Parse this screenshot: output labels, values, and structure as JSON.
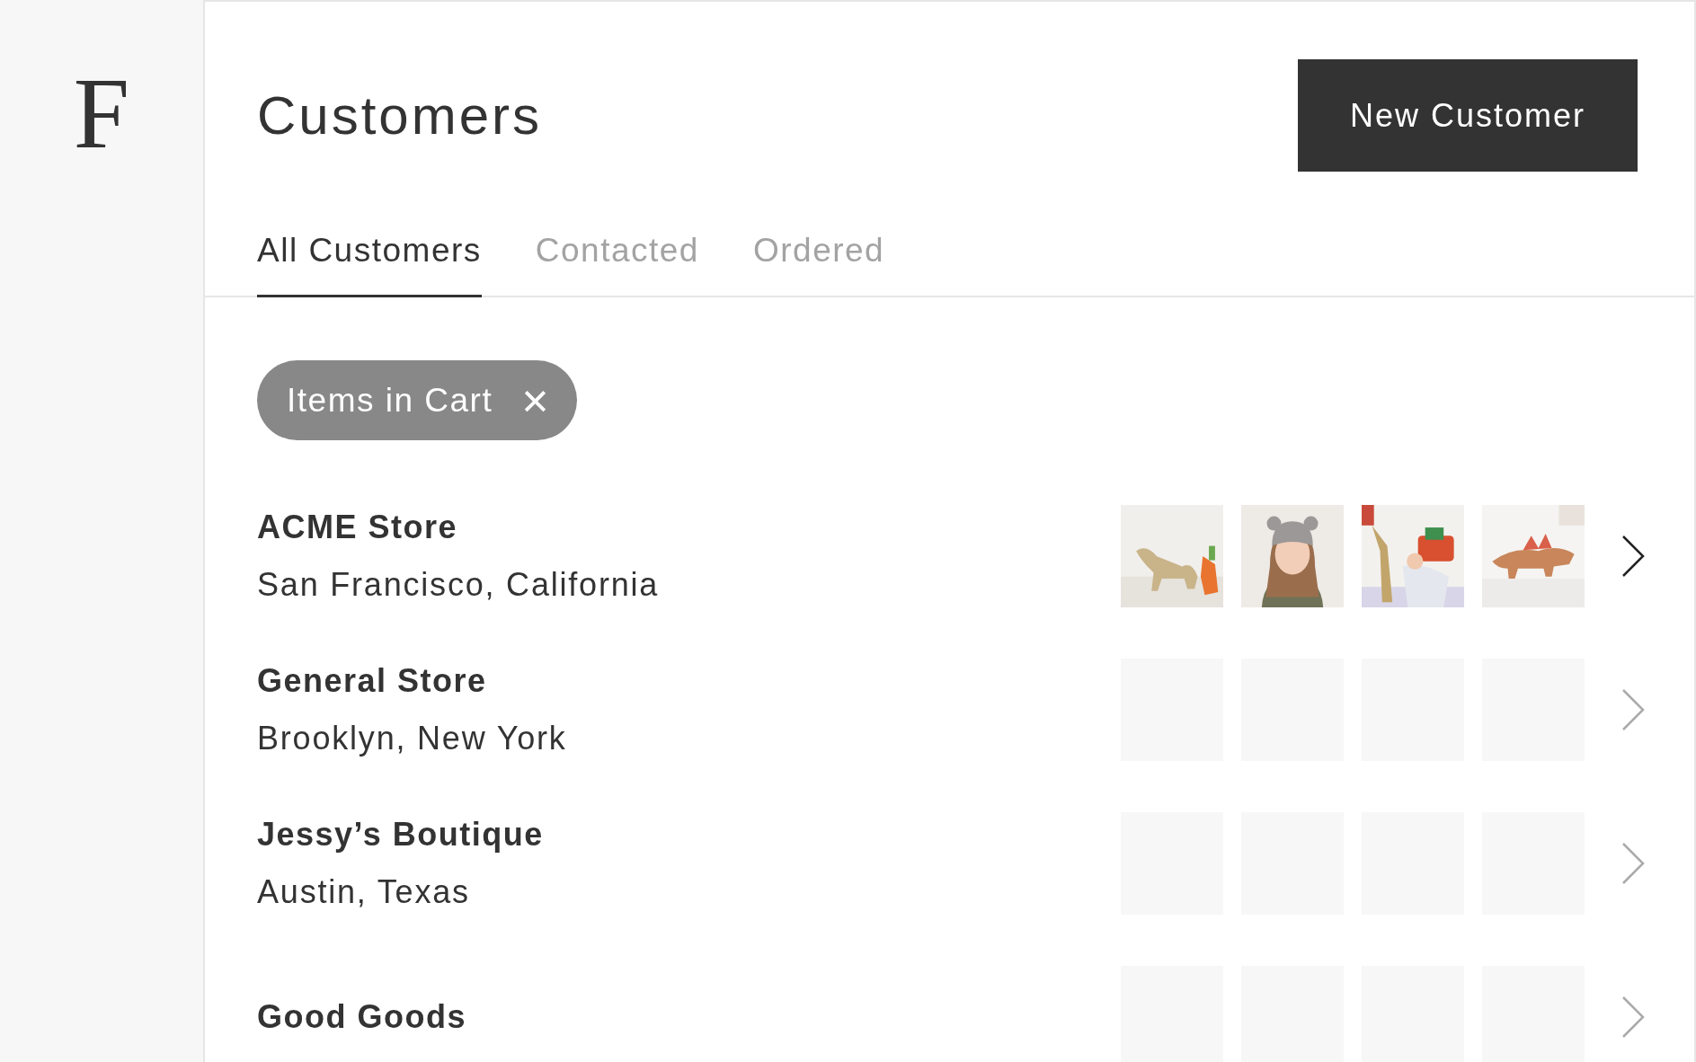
{
  "sidebar": {
    "logo": "F"
  },
  "header": {
    "title": "Customers",
    "button": "New Customer"
  },
  "tabs": [
    {
      "label": "All Customers",
      "selected": true
    },
    {
      "label": "Contacted",
      "selected": false
    },
    {
      "label": "Ordered",
      "selected": false
    }
  ],
  "filters": [
    {
      "label": "Items in Cart",
      "close": "×"
    }
  ],
  "customers": [
    {
      "name": "ACME Store",
      "location": "San Francisco, California",
      "active": true
    },
    {
      "name": "General Store",
      "location": "Brooklyn, New York",
      "active": false,
      "thumbnails": [
        {
          "kind": "empty"
        },
        {
          "kind": "empty"
        },
        {
          "kind": "empty"
        },
        {
          "kind": "empty"
        }
      ]
    },
    {
      "name": "Jessy’s Boutique",
      "location": "Austin, Texas",
      "active": false,
      "thumbnails": [
        {
          "kind": "empty"
        },
        {
          "kind": "empty"
        },
        {
          "kind": "empty"
        },
        {
          "kind": "empty"
        }
      ]
    },
    {
      "name": "Good Goods",
      "active": false,
      "thumbnails": [
        {
          "kind": "empty"
        },
        {
          "kind": "empty"
        },
        {
          "kind": "empty"
        },
        {
          "kind": "empty"
        }
      ]
    }
  ]
}
